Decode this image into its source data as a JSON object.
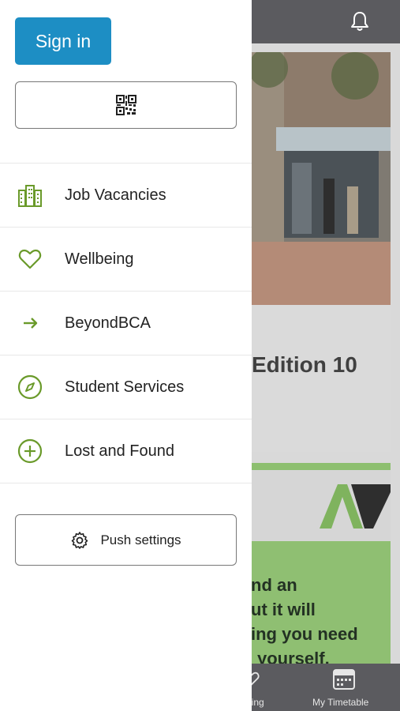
{
  "drawer": {
    "sign_in_label": "Sign in",
    "qr_icon": "qr-code-icon",
    "menu": [
      {
        "label": "Job Vacancies",
        "icon": "buildings-icon"
      },
      {
        "label": "Wellbeing",
        "icon": "heart-icon"
      },
      {
        "label": "BeyondBCA",
        "icon": "arrow-right-icon"
      },
      {
        "label": "Student Services",
        "icon": "compass-icon"
      },
      {
        "label": "Lost and Found",
        "icon": "plus-circle-icon"
      }
    ],
    "push_settings_label": "Push settings",
    "accent_color": "#6a9a2a",
    "button_color": "#1d8ec4"
  },
  "background": {
    "card_title": "Edition 10",
    "promo_lines": [
      "nd an",
      "ut it will",
      "ing you need",
      "yourself."
    ],
    "tabs": [
      {
        "label": "eing",
        "icon": "heart-icon"
      },
      {
        "label": "My Timetable",
        "icon": "calendar-icon"
      }
    ]
  }
}
